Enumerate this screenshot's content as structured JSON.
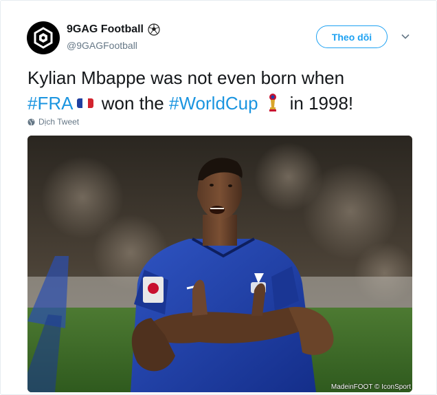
{
  "account": {
    "name": "9GAG Football",
    "name_emoji_icon": "soccer-ball-icon",
    "handle": "@9GAGFootball",
    "avatar_icon": "9gag-logo-icon"
  },
  "actions": {
    "follow_label": "Theo dõi",
    "more_icon": "chevron-down-icon"
  },
  "tweet": {
    "line1": "Kylian Mbappe was not even born when",
    "hashtag_fra": "#FRA",
    "flag_icon": "france-flag-icon",
    "mid_text": "won the",
    "hashtag_worldcup": "#WorldCup",
    "trophy_icon": "world-cup-trophy-icon",
    "end_text": "in 1998!",
    "translate_label": "Dịch Tweet",
    "translate_icon": "globe-icon"
  },
  "media": {
    "credit": "MadeinFOOT © IconSport"
  },
  "colors": {
    "accent": "#1da1f2",
    "hashtag": "#1b95e0",
    "muted": "#657786",
    "jersey": "#1e3fa6"
  }
}
